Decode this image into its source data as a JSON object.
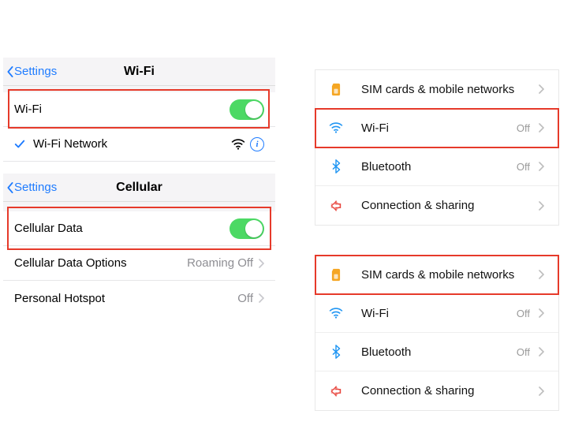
{
  "ios_wifi": {
    "back_label": "Settings",
    "title": "Wi-Fi",
    "toggle_label": "Wi-Fi",
    "network_name": "Wi-Fi Network"
  },
  "ios_cellular": {
    "back_label": "Settings",
    "title": "Cellular",
    "data_label": "Cellular Data",
    "options_label": "Cellular Data Options",
    "options_status": "Roaming Off",
    "hotspot_label": "Personal Hotspot",
    "hotspot_status": "Off"
  },
  "android_top": {
    "items": [
      {
        "label": "SIM cards & mobile networks",
        "status": ""
      },
      {
        "label": "Wi-Fi",
        "status": "Off"
      },
      {
        "label": "Bluetooth",
        "status": "Off"
      },
      {
        "label": "Connection & sharing",
        "status": ""
      }
    ]
  },
  "android_bottom": {
    "items": [
      {
        "label": "SIM cards & mobile networks",
        "status": ""
      },
      {
        "label": "Wi-Fi",
        "status": "Off"
      },
      {
        "label": "Bluetooth",
        "status": "Off"
      },
      {
        "label": "Connection & sharing",
        "status": ""
      }
    ]
  }
}
